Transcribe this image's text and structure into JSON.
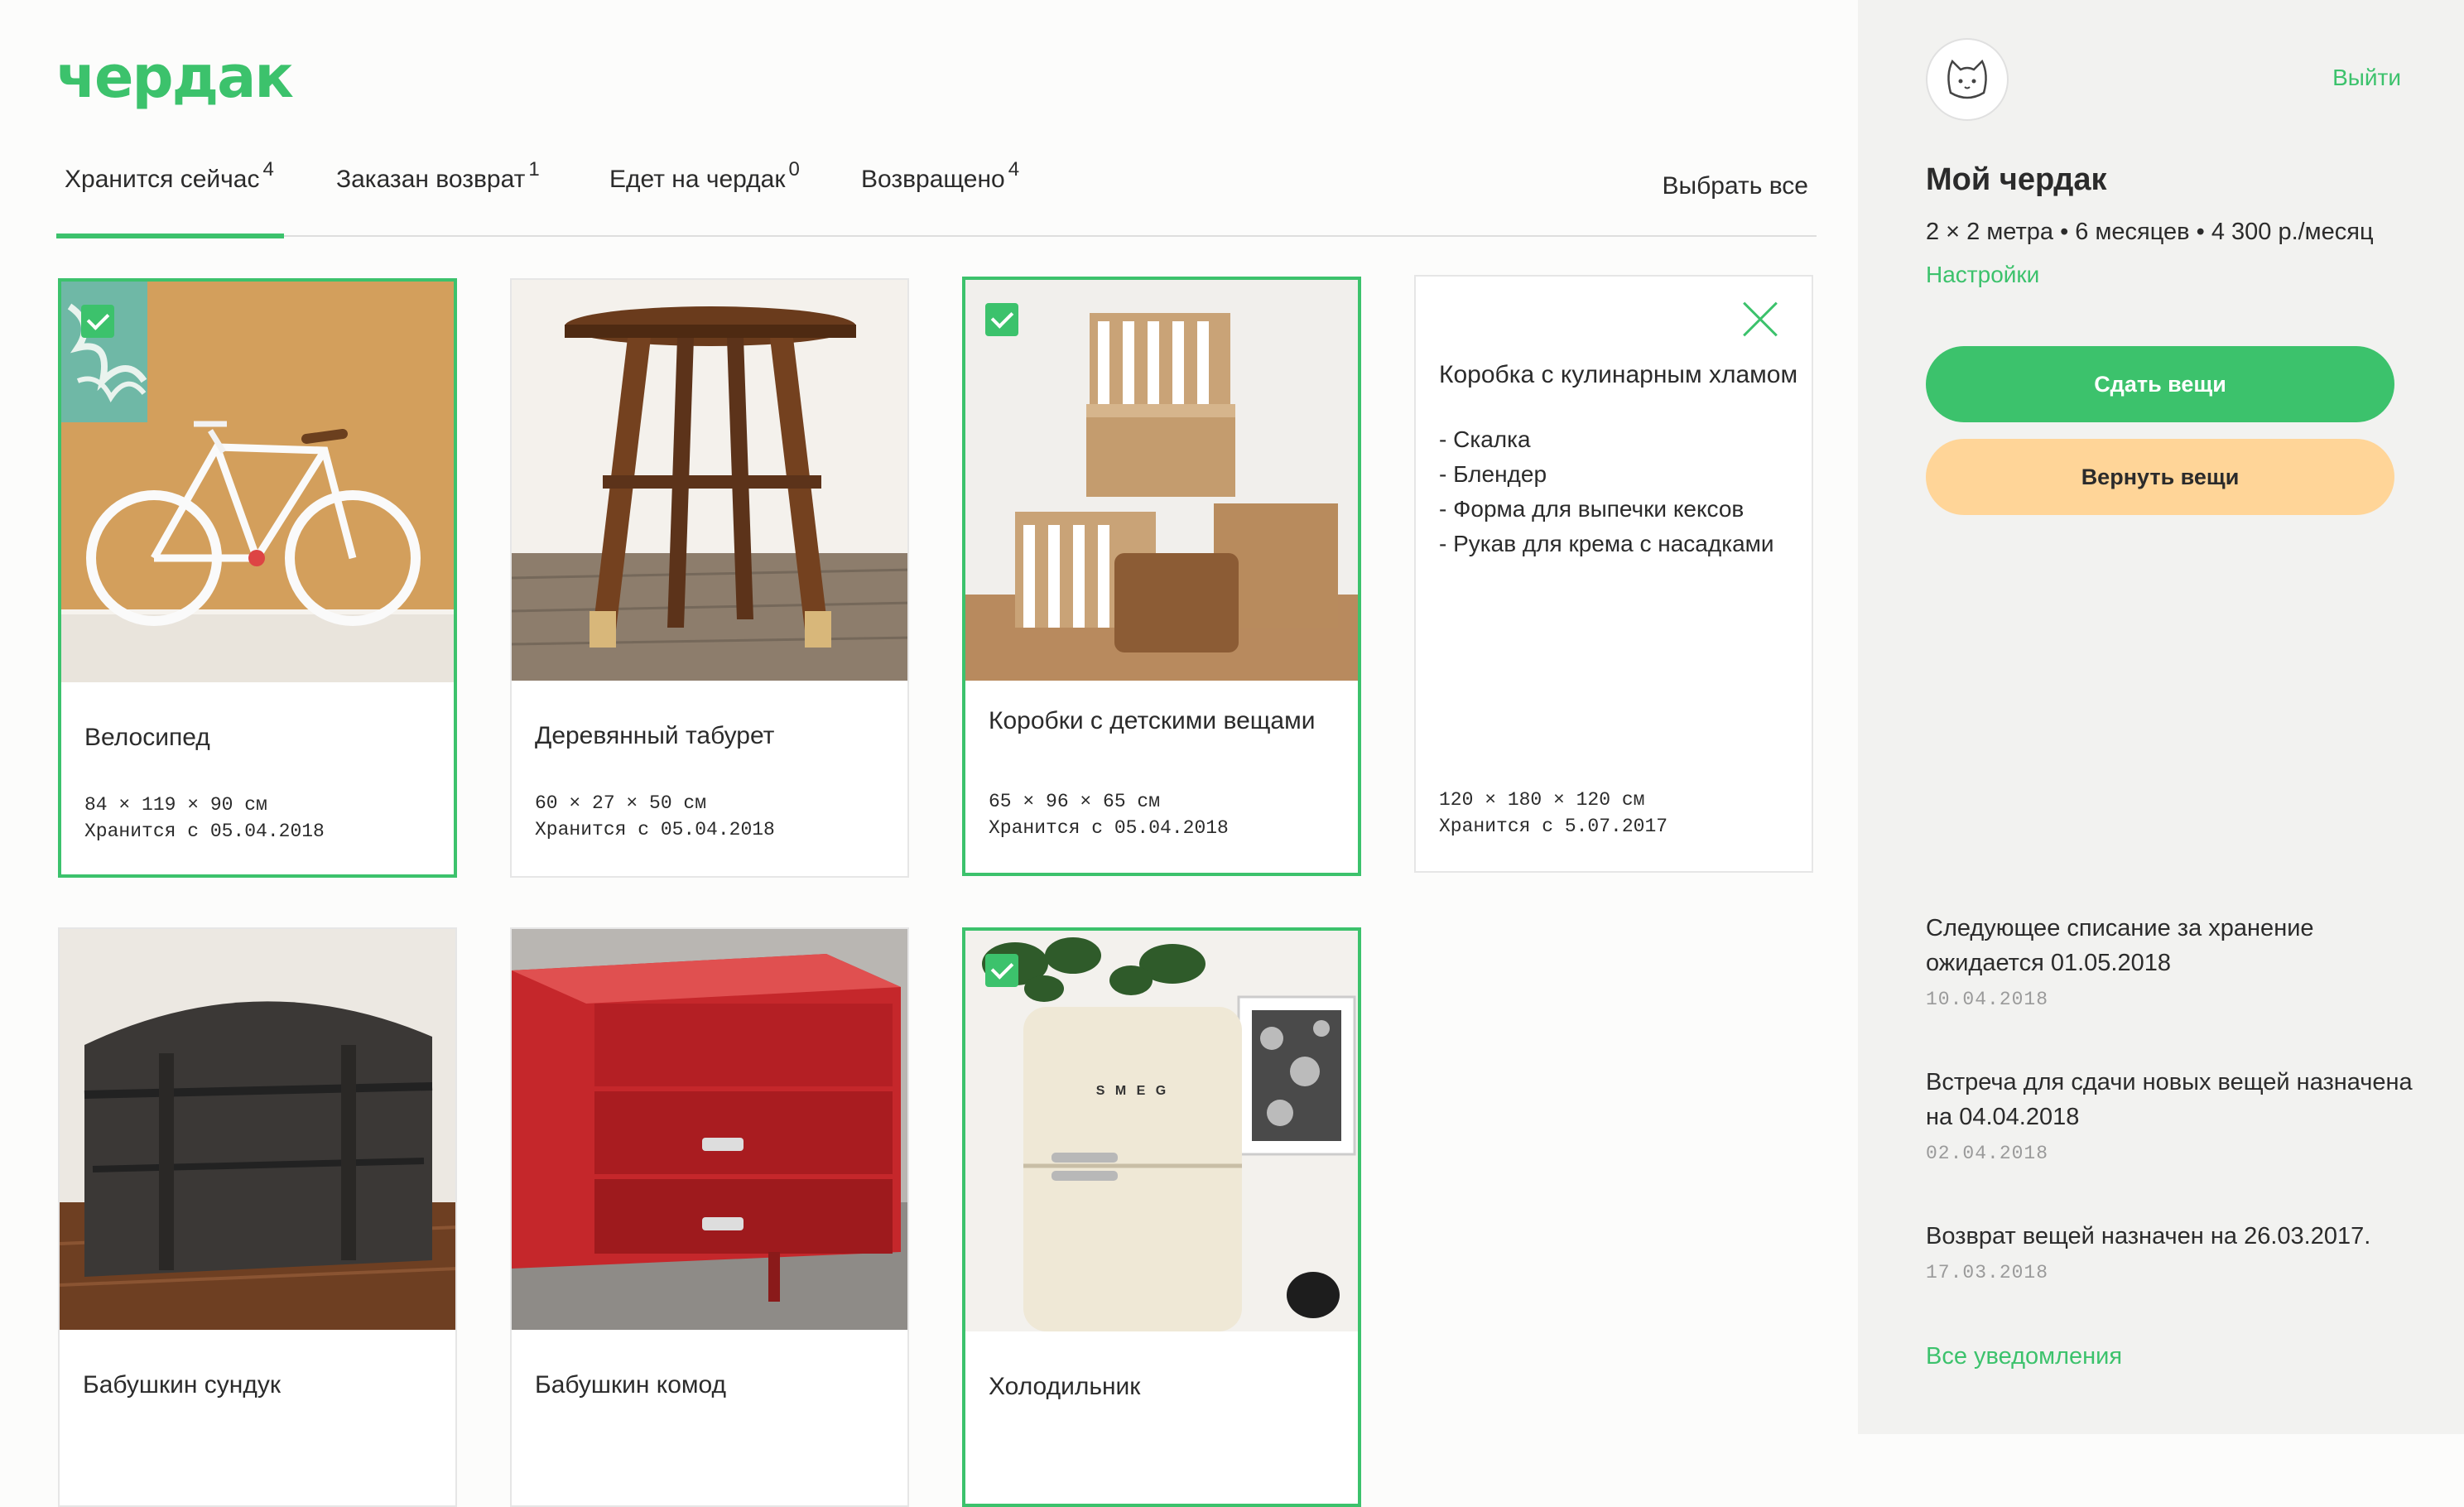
{
  "logo": "чердак",
  "tabs": [
    {
      "label": "Хранится сейчас",
      "count": "4"
    },
    {
      "label": "Заказан возврат",
      "count": "1"
    },
    {
      "label": "Едет на чердак",
      "count": "0"
    },
    {
      "label": "Возвращено",
      "count": "4"
    }
  ],
  "select_all": "Выбрать все",
  "items": [
    {
      "title": "Велосипед",
      "size": "84 × 119 × 90 см",
      "since": "Хранится с 05.04.2018",
      "selected": true
    },
    {
      "title": "Деревянный табурет",
      "size": "60 × 27 × 50 см",
      "since": "Хранится с 05.04.2018",
      "selected": false
    },
    {
      "title": "Коробки с детскими вещами",
      "size": "65 × 96 × 65 см",
      "since": "Хранится с 05.04.2018",
      "selected": true
    },
    {
      "title": "Коробка с кулинарным хламом",
      "description": "- Скалка\n- Блендер\n- Форма для выпечки кексов\n- Рукав для крема с насадками",
      "size": "120 × 180 × 120 см",
      "since": "Хранится с 5.07.2017",
      "selected": false
    },
    {
      "title": "Бабушкин сундук",
      "selected": false
    },
    {
      "title": "Бабушкин комод",
      "selected": false
    },
    {
      "title": "Холодильник",
      "selected": true
    }
  ],
  "fridge_brand": "S M E G",
  "sidebar": {
    "logout": "Выйти",
    "title": "Мой чердак",
    "plan": "2 × 2 метра • 6 месяцев • 4 300 р./месяц",
    "settings": "Настройки",
    "give_button": "Сдать вещи",
    "return_button": "Вернуть вещи",
    "notifications": [
      {
        "text": "Следующее списание за хранение ожидается 01.05.2018",
        "date": "10.04.2018"
      },
      {
        "text": "Встреча для сдачи новых вещей назначена на 04.04.2018",
        "date": "02.04.2018"
      },
      {
        "text": "Возврат вещей назначен на 26.03.2017.",
        "date": "17.03.2018"
      }
    ],
    "all_notifications": "Все уведомления"
  },
  "colors": {
    "accent": "#3cc26c",
    "return_button": "#ffd598",
    "sidebar_bg": "#f2f2f0"
  }
}
